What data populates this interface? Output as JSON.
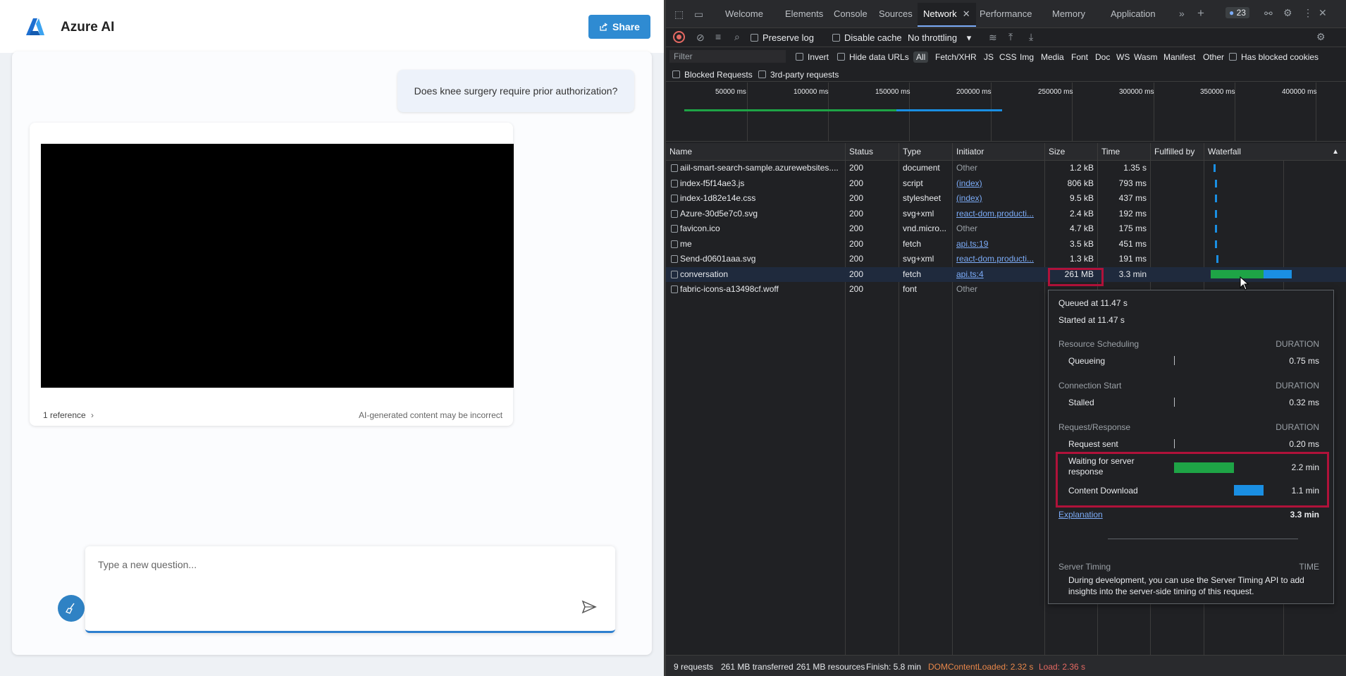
{
  "app": {
    "title": "Azure AI",
    "share_label": "Share",
    "user_message": "Does knee surgery require prior authorization?",
    "reference_label": "1 reference",
    "ai_disclaimer": "AI-generated content may be incorrect",
    "question_placeholder": "Type a new question..."
  },
  "devtools": {
    "tabs": [
      "Welcome",
      "Elements",
      "Console",
      "Sources",
      "Network",
      "Performance",
      "Memory",
      "Application"
    ],
    "active_tab": "Network",
    "issues_count": "23",
    "toolbar": {
      "preserve_log": "Preserve log",
      "disable_cache": "Disable cache",
      "throttling": "No throttling"
    },
    "filter": {
      "placeholder": "Filter",
      "invert": "Invert",
      "hide_data_urls": "Hide data URLs",
      "types": [
        "All",
        "Fetch/XHR",
        "JS",
        "CSS",
        "Img",
        "Media",
        "Font",
        "Doc",
        "WS",
        "Wasm",
        "Manifest",
        "Other"
      ],
      "has_blocked_cookies": "Has blocked cookies",
      "blocked_requests": "Blocked Requests",
      "third_party": "3rd-party requests"
    },
    "overview_ticks": [
      "50000 ms",
      "100000 ms",
      "150000 ms",
      "200000 ms",
      "250000 ms",
      "300000 ms",
      "350000 ms",
      "400000 ms"
    ],
    "columns": [
      "Name",
      "Status",
      "Type",
      "Initiator",
      "Size",
      "Time",
      "Fulfilled by",
      "Waterfall"
    ],
    "requests": [
      {
        "name": "aiil-smart-search-sample.azurewebsites....",
        "status": "200",
        "type": "document",
        "initiator": "Other",
        "initiator_link": false,
        "size": "1.2 kB",
        "time": "1.35 s"
      },
      {
        "name": "index-f5f14ae3.js",
        "status": "200",
        "type": "script",
        "initiator": "(index)",
        "initiator_link": true,
        "size": "806 kB",
        "time": "793 ms"
      },
      {
        "name": "index-1d82e14e.css",
        "status": "200",
        "type": "stylesheet",
        "initiator": "(index)",
        "initiator_link": true,
        "size": "9.5 kB",
        "time": "437 ms"
      },
      {
        "name": "Azure-30d5e7c0.svg",
        "status": "200",
        "type": "svg+xml",
        "initiator": "react-dom.producti...",
        "initiator_link": true,
        "size": "2.4 kB",
        "time": "192 ms"
      },
      {
        "name": "favicon.ico",
        "status": "200",
        "type": "vnd.micro...",
        "initiator": "Other",
        "initiator_link": false,
        "size": "4.7 kB",
        "time": "175 ms"
      },
      {
        "name": "me",
        "status": "200",
        "type": "fetch",
        "initiator": "api.ts:19",
        "initiator_link": true,
        "size": "3.5 kB",
        "time": "451 ms"
      },
      {
        "name": "Send-d0601aaa.svg",
        "status": "200",
        "type": "svg+xml",
        "initiator": "react-dom.producti...",
        "initiator_link": true,
        "size": "1.3 kB",
        "time": "191 ms"
      },
      {
        "name": "conversation",
        "status": "200",
        "type": "fetch",
        "initiator": "api.ts:4",
        "initiator_link": true,
        "size": "261 MB",
        "time": "3.3 min"
      },
      {
        "name": "fabric-icons-a13498cf.woff",
        "status": "200",
        "type": "font",
        "initiator": "Other",
        "initiator_link": false,
        "size": "",
        "time": ""
      }
    ],
    "timing": {
      "queued_at": "Queued at 11.47 s",
      "started_at": "Started at 11.47 s",
      "sections": [
        {
          "title": "Resource Scheduling",
          "header_right": "DURATION",
          "rows": [
            {
              "label": "Queueing",
              "value": "0.75 ms"
            }
          ]
        },
        {
          "title": "Connection Start",
          "header_right": "DURATION",
          "rows": [
            {
              "label": "Stalled",
              "value": "0.32 ms"
            }
          ]
        },
        {
          "title": "Request/Response",
          "header_right": "DURATION",
          "rows": [
            {
              "label": "Request sent",
              "value": "0.20 ms"
            },
            {
              "label": "Waiting for server response",
              "value": "2.2 min"
            },
            {
              "label": "Content Download",
              "value": "1.1 min"
            }
          ]
        }
      ],
      "explanation": "Explanation",
      "total": "3.3 min",
      "server_timing_title": "Server Timing",
      "server_timing_header": "TIME",
      "server_timing_text": "During development, you can use the Server Timing API to add insights into the server-side timing of this request."
    },
    "status": {
      "requests": "9 requests",
      "transferred": "261 MB transferred",
      "resources": "261 MB resources",
      "finish": "Finish: 5.8 min",
      "dom_content_loaded": "DOMContentLoaded: 2.32 s",
      "load": "Load: 2.36 s"
    },
    "colors": {
      "waiting": "#1ea446",
      "download": "#1a8fe3",
      "highlight": "#b0123a",
      "dcl": "#e8874a",
      "load": "#e46962"
    }
  }
}
